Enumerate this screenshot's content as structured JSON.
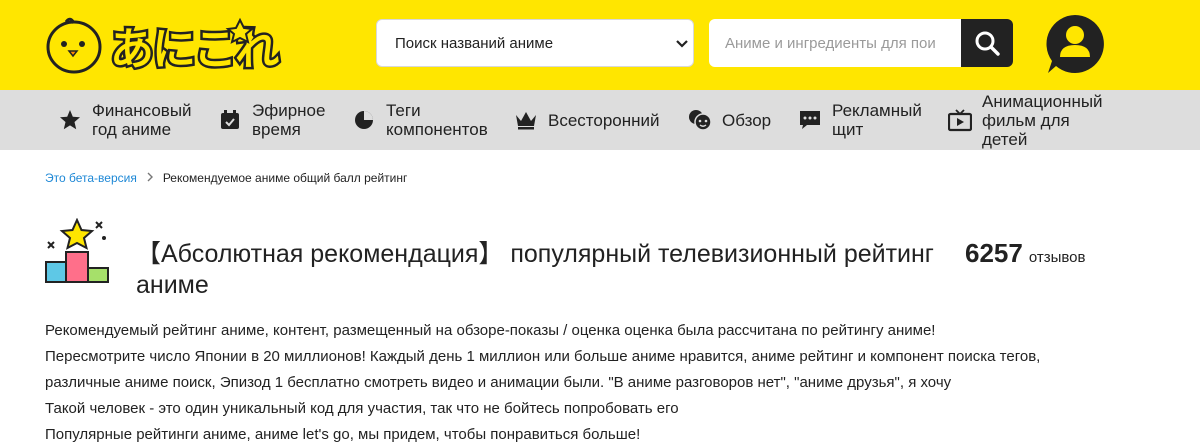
{
  "header": {
    "logo_text": "あにこれ",
    "search_select": {
      "selected": "Поиск названий аниме"
    },
    "search_input": {
      "placeholder": "Аниме и ингредиенты для пои",
      "value": ""
    }
  },
  "nav": {
    "items": [
      {
        "label": "Финансовый год аниме",
        "icon": "star-icon"
      },
      {
        "label": "Эфирное время",
        "icon": "calendar-icon"
      },
      {
        "label": "Теги компонентов",
        "icon": "pie-chart-icon"
      },
      {
        "label": "Всесторонний",
        "icon": "crown-icon"
      },
      {
        "label": "Обзор",
        "icon": "faces-icon"
      },
      {
        "label": "Рекламный щит",
        "icon": "comment-icon"
      },
      {
        "label": "Анимационный фильм для детей",
        "icon": "tv-icon"
      }
    ]
  },
  "breadcrumb": {
    "home": "Это бета-версия",
    "current": "Рекомендуемое аниме общий балл рейтинг"
  },
  "title": "【Абсолютная рекомендация】 популярный телевизионный рейтинг аниме",
  "reviews": {
    "count": "6257",
    "unit": "отзывов"
  },
  "description": [
    "Рекомендуемый рейтинг аниме, контент, размещенный на обзоре-показы / оценка оценка была рассчитана по рейтингу аниме!",
    "Пересмотрите число Японии в 20 миллионов! Каждый день 1 миллион или больше аниме нравится, аниме рейтинг и компонент поиска тегов,",
    "различные аниме поиск, Эпизод 1 бесплатно смотреть видео и анимации были. \"В аниме разговоров нет\", \"аниме друзья\", я хочу",
    "Такой человек - это один уникальный код для участия, так что не бойтесь попробовать его",
    "Популярные рейтинги аниме, аниме let's go, мы придем, чтобы понравиться больше!"
  ],
  "colors": {
    "brand_yellow": "#ffe600",
    "nav_gray": "#dddddd",
    "link_blue": "#1e88d6",
    "dark": "#222222"
  }
}
